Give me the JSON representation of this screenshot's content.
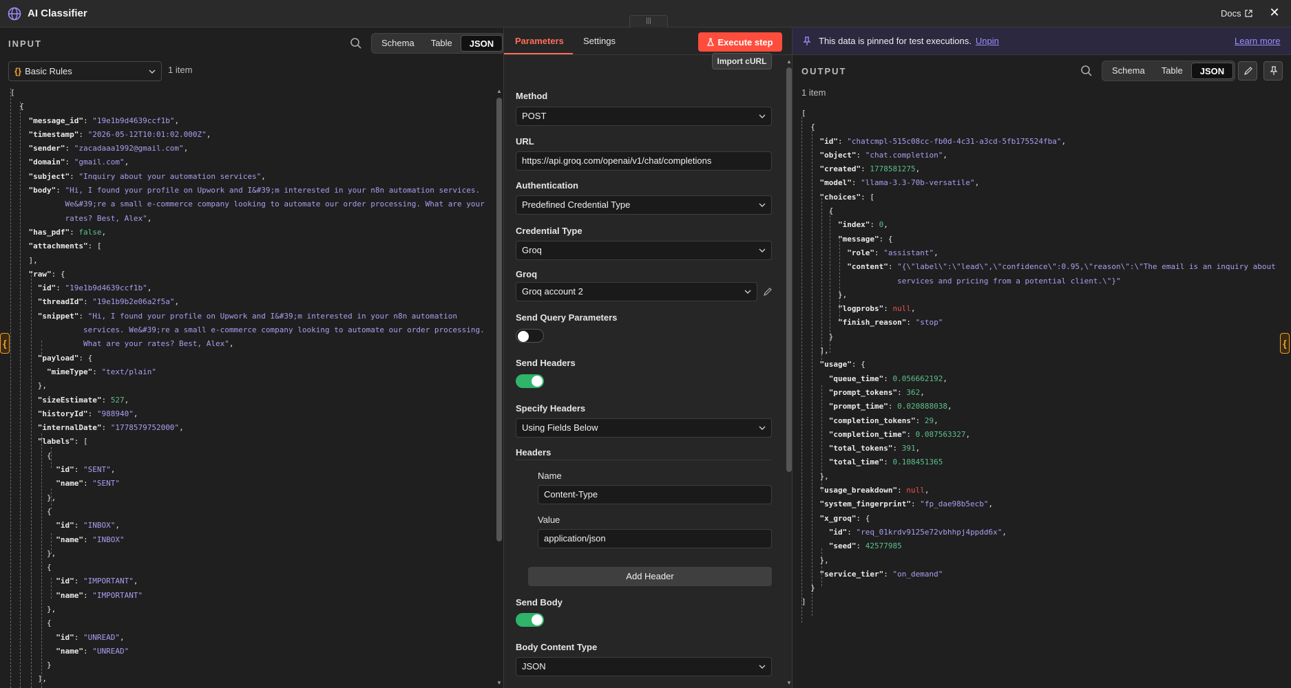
{
  "app": {
    "title": "AI Classifier",
    "docs_label": "Docs",
    "close_label": "✕",
    "drag_label": "|||"
  },
  "input": {
    "title": "INPUT",
    "views": [
      "Schema",
      "Table",
      "JSON"
    ],
    "active_view": "JSON",
    "rules_label": "Basic Rules",
    "item_count": "1 item"
  },
  "params": {
    "tabs": [
      "Parameters",
      "Settings"
    ],
    "active_tab": "Parameters",
    "execute_label": "Execute step",
    "import_label": "Import cURL",
    "method_label": "Method",
    "method_value": "POST",
    "url_label": "URL",
    "url_value": "https://api.groq.com/openai/v1/chat/completions",
    "auth_label": "Authentication",
    "auth_value": "Predefined Credential Type",
    "cred_type_label": "Credential Type",
    "cred_type_value": "Groq",
    "groq_label": "Groq",
    "groq_value": "Groq account 2",
    "send_query_label": "Send Query Parameters",
    "send_query_on": false,
    "send_headers_label": "Send Headers",
    "send_headers_on": true,
    "specify_headers_label": "Specify Headers",
    "specify_headers_value": "Using Fields Below",
    "headers_label": "Headers",
    "name_label": "Name",
    "name_value": "Content-Type",
    "value_label": "Value",
    "value_value": "application/json",
    "add_header_label": "Add Header",
    "send_body_label": "Send Body",
    "send_body_on": true,
    "body_type_label": "Body Content Type",
    "body_type_value": "JSON"
  },
  "output": {
    "pin_text": "This data is pinned for test executions.",
    "unpin_label": "Unpin",
    "learn_more_label": "Learn more",
    "title": "OUTPUT",
    "views": [
      "Schema",
      "Table",
      "JSON"
    ],
    "active_view": "JSON",
    "item_count": "1 item"
  },
  "colors": {
    "accent": "#ff6d5a",
    "string": "#a99ff0",
    "number": "#5cc08a",
    "null": "#f05050",
    "toggle_on": "#2fb46a"
  },
  "input_json": [
    [
      "["
    ],
    [
      "  {"
    ],
    [
      "    ",
      [
        "k",
        "\"message_id\""
      ],
      ": ",
      [
        "s",
        "\"19e1b9d4639ccf1b\""
      ],
      ","
    ],
    [
      "    ",
      [
        "k",
        "\"timestamp\""
      ],
      ": ",
      [
        "s",
        "\"2026-05-12T10:01:02.000Z\""
      ],
      ","
    ],
    [
      "    ",
      [
        "k",
        "\"sender\""
      ],
      ": ",
      [
        "s",
        "\"zacadaaa1992@gmail.com\""
      ],
      ","
    ],
    [
      "    ",
      [
        "k",
        "\"domain\""
      ],
      ": ",
      [
        "s",
        "\"gmail.com\""
      ],
      ","
    ],
    [
      "    ",
      [
        "k",
        "\"subject\""
      ],
      ": ",
      [
        "s",
        "\"Inquiry about your automation services\""
      ],
      ","
    ],
    [
      "    ",
      [
        "k",
        "\"body\""
      ],
      ": ",
      [
        "s",
        "\"Hi, I found your profile on Upwork and I&#39;m interested in your n8n automation services."
      ]
    ],
    [
      "            ",
      [
        "s",
        "We&#39;re a small e-commerce company looking to automate our order processing. What are your"
      ]
    ],
    [
      "            ",
      [
        "s",
        "rates? Best, Alex\""
      ],
      ","
    ],
    [
      "    ",
      [
        "k",
        "\"has_pdf\""
      ],
      ": ",
      [
        "b",
        "false"
      ],
      ","
    ],
    [
      "    ",
      [
        "k",
        "\"attachments\""
      ],
      ": ["
    ],
    [
      "    ],"
    ],
    [
      "    ",
      [
        "k",
        "\"raw\""
      ],
      ": {"
    ],
    [
      "      ",
      [
        "k",
        "\"id\""
      ],
      ": ",
      [
        "s",
        "\"19e1b9d4639ccf1b\""
      ],
      ","
    ],
    [
      "      ",
      [
        "k",
        "\"threadId\""
      ],
      ": ",
      [
        "s",
        "\"19e1b9b2e06a2f5a\""
      ],
      ","
    ],
    [
      "      ",
      [
        "k",
        "\"snippet\""
      ],
      ": ",
      [
        "s",
        "\"Hi, I found your profile on Upwork and I&#39;m interested in your n8n automation"
      ]
    ],
    [
      "                ",
      [
        "s",
        "services. We&#39;re a small e-commerce company looking to automate our order processing."
      ]
    ],
    [
      "                ",
      [
        "s",
        "What are your rates? Best, Alex\""
      ],
      ","
    ],
    [
      "      ",
      [
        "k",
        "\"payload\""
      ],
      ": {"
    ],
    [
      "        ",
      [
        "k",
        "\"mimeType\""
      ],
      ": ",
      [
        "s",
        "\"text/plain\""
      ]
    ],
    [
      "      },"
    ],
    [
      "      ",
      [
        "k",
        "\"sizeEstimate\""
      ],
      ": ",
      [
        "n",
        "527"
      ],
      ","
    ],
    [
      "      ",
      [
        "k",
        "\"historyId\""
      ],
      ": ",
      [
        "s",
        "\"988940\""
      ],
      ","
    ],
    [
      "      ",
      [
        "k",
        "\"internalDate\""
      ],
      ": ",
      [
        "s",
        "\"1778579752000\""
      ],
      ","
    ],
    [
      "      ",
      [
        "k",
        "\"labels\""
      ],
      ": ["
    ],
    [
      "        {"
    ],
    [
      "          ",
      [
        "k",
        "\"id\""
      ],
      ": ",
      [
        "s",
        "\"SENT\""
      ],
      ","
    ],
    [
      "          ",
      [
        "k",
        "\"name\""
      ],
      ": ",
      [
        "s",
        "\"SENT\""
      ]
    ],
    [
      "        },"
    ],
    [
      "        {"
    ],
    [
      "          ",
      [
        "k",
        "\"id\""
      ],
      ": ",
      [
        "s",
        "\"INBOX\""
      ],
      ","
    ],
    [
      "          ",
      [
        "k",
        "\"name\""
      ],
      ": ",
      [
        "s",
        "\"INBOX\""
      ]
    ],
    [
      "        },"
    ],
    [
      "        {"
    ],
    [
      "          ",
      [
        "k",
        "\"id\""
      ],
      ": ",
      [
        "s",
        "\"IMPORTANT\""
      ],
      ","
    ],
    [
      "          ",
      [
        "k",
        "\"name\""
      ],
      ": ",
      [
        "s",
        "\"IMPORTANT\""
      ]
    ],
    [
      "        },"
    ],
    [
      "        {"
    ],
    [
      "          ",
      [
        "k",
        "\"id\""
      ],
      ": ",
      [
        "s",
        "\"UNREAD\""
      ],
      ","
    ],
    [
      "          ",
      [
        "k",
        "\"name\""
      ],
      ": ",
      [
        "s",
        "\"UNREAD\""
      ]
    ],
    [
      "        }"
    ],
    [
      "      ],"
    ]
  ],
  "output_json": [
    [
      "["
    ],
    [
      "  {"
    ],
    [
      "    ",
      [
        "k",
        "\"id\""
      ],
      ": ",
      [
        "s",
        "\"chatcmpl-515c08cc-fb0d-4c31-a3cd-5fb175524fba\""
      ],
      ","
    ],
    [
      "    ",
      [
        "k",
        "\"object\""
      ],
      ": ",
      [
        "s",
        "\"chat.completion\""
      ],
      ","
    ],
    [
      "    ",
      [
        "k",
        "\"created\""
      ],
      ": ",
      [
        "n",
        "1778581275"
      ],
      ","
    ],
    [
      "    ",
      [
        "k",
        "\"model\""
      ],
      ": ",
      [
        "s",
        "\"llama-3.3-70b-versatile\""
      ],
      ","
    ],
    [
      "    ",
      [
        "k",
        "\"choices\""
      ],
      ": ["
    ],
    [
      "      {"
    ],
    [
      "        ",
      [
        "k",
        "\"index\""
      ],
      ": ",
      [
        "n",
        "0"
      ],
      ","
    ],
    [
      "        ",
      [
        "k",
        "\"message\""
      ],
      ": {"
    ],
    [
      "          ",
      [
        "k",
        "\"role\""
      ],
      ": ",
      [
        "s",
        "\"assistant\""
      ],
      ","
    ],
    [
      "          ",
      [
        "k",
        "\"content\""
      ],
      ": ",
      [
        "s",
        "\"{\\\"label\\\":\\\"lead\\\",\\\"confidence\\\":0.95,\\\"reason\\\":\\\"The email is an inquiry about"
      ]
    ],
    [
      "                     ",
      [
        "s",
        "services and pricing from a potential client.\\\"}\""
      ]
    ],
    [
      "        },"
    ],
    [
      "        ",
      [
        "k",
        "\"logprobs\""
      ],
      ": ",
      [
        "nl",
        "null"
      ],
      ","
    ],
    [
      "        ",
      [
        "k",
        "\"finish_reason\""
      ],
      ": ",
      [
        "s",
        "\"stop\""
      ]
    ],
    [
      "      }"
    ],
    [
      "    ],"
    ],
    [
      "    ",
      [
        "k",
        "\"usage\""
      ],
      ": {"
    ],
    [
      "      ",
      [
        "k",
        "\"queue_time\""
      ],
      ": ",
      [
        "n",
        "0.056662192"
      ],
      ","
    ],
    [
      "      ",
      [
        "k",
        "\"prompt_tokens\""
      ],
      ": ",
      [
        "n",
        "362"
      ],
      ","
    ],
    [
      "      ",
      [
        "k",
        "\"prompt_time\""
      ],
      ": ",
      [
        "n",
        "0.020888038"
      ],
      ","
    ],
    [
      "      ",
      [
        "k",
        "\"completion_tokens\""
      ],
      ": ",
      [
        "n",
        "29"
      ],
      ","
    ],
    [
      "      ",
      [
        "k",
        "\"completion_time\""
      ],
      ": ",
      [
        "n",
        "0.087563327"
      ],
      ","
    ],
    [
      "      ",
      [
        "k",
        "\"total_tokens\""
      ],
      ": ",
      [
        "n",
        "391"
      ],
      ","
    ],
    [
      "      ",
      [
        "k",
        "\"total_time\""
      ],
      ": ",
      [
        "n",
        "0.108451365"
      ]
    ],
    [
      "    },"
    ],
    [
      "    ",
      [
        "k",
        "\"usage_breakdown\""
      ],
      ": ",
      [
        "nl",
        "null"
      ],
      ","
    ],
    [
      "    ",
      [
        "k",
        "\"system_fingerprint\""
      ],
      ": ",
      [
        "s",
        "\"fp_dae98b5ecb\""
      ],
      ","
    ],
    [
      "    ",
      [
        "k",
        "\"x_groq\""
      ],
      ": {"
    ],
    [
      "      ",
      [
        "k",
        "\"id\""
      ],
      ": ",
      [
        "s",
        "\"req_01krdv9125e72vbhhpj4ppdd6x\""
      ],
      ","
    ],
    [
      "      ",
      [
        "k",
        "\"seed\""
      ],
      ": ",
      [
        "n",
        "42577985"
      ]
    ],
    [
      "    },"
    ],
    [
      "    ",
      [
        "k",
        "\"service_tier\""
      ],
      ": ",
      [
        "s",
        "\"on_demand\""
      ]
    ],
    [
      "  }"
    ],
    [
      "]"
    ]
  ]
}
